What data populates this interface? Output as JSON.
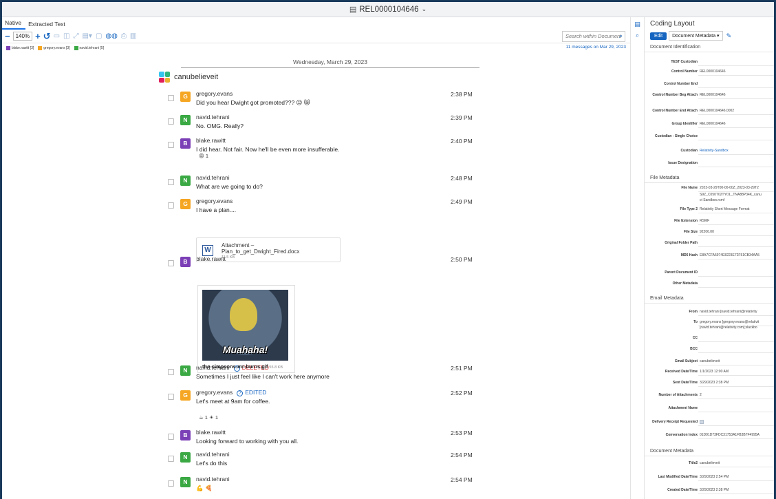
{
  "title": "REL0000104646",
  "tabs": [
    "Native",
    "Extracted Text"
  ],
  "toolbar": {
    "zoom": "140%"
  },
  "search": {
    "placeholder": "Search within Document"
  },
  "filters": [
    {
      "label": "blake.rawitt [3]",
      "color": "#7b3fb6"
    },
    {
      "label": "gregory.evans [3]",
      "color": "#f5a623"
    },
    {
      "label": "navid.tehrani [5]",
      "color": "#3aa843"
    }
  ],
  "message_count": "11 messages on Mar 29, 2023",
  "chat": {
    "date": "Wednesday, March 29, 2023",
    "channel": "canubelieveit",
    "messages": [
      {
        "user": "gregory.evans",
        "initial": "G",
        "color": "#f5a623",
        "text": "Did you hear Dwight got promoted??? 😐 😿",
        "time": "2:38 PM"
      },
      {
        "user": "navid.tehrani",
        "initial": "N",
        "color": "#3aa843",
        "text": "No. OMG. Really?",
        "time": "2:39 PM"
      },
      {
        "user": "blake.rawitt",
        "initial": "B",
        "color": "#7b3fb6",
        "text": "I did hear. Not fair. Now he'll be even more insufferable.",
        "time": "2:40 PM",
        "reaction": "😡 1"
      },
      {
        "user": "navid.tehrani",
        "initial": "N",
        "color": "#3aa843",
        "text": "What are we going to do?",
        "time": "2:48 PM"
      },
      {
        "user": "gregory.evans",
        "initial": "G",
        "color": "#f5a623",
        "text": "I have a plan....",
        "time": "2:49 PM"
      },
      {
        "user": "blake.rawitt",
        "initial": "B",
        "color": "#7b3fb6",
        "text": "",
        "time": "2:50 PM"
      },
      {
        "user": "navid.tehrani",
        "initial": "N",
        "color": "#3aa843",
        "text": "Sometimes I just feel like I can't work here anymore",
        "time": "2:51 PM",
        "tag": "DELETED"
      },
      {
        "user": "gregory.evans",
        "initial": "G",
        "color": "#f5a623",
        "text": "Let's meet at 9am for coffee.",
        "time": "2:52 PM",
        "tag": "EDITED",
        "reaction": "☕ 1    ☀ 1"
      },
      {
        "user": "blake.rawitt",
        "initial": "B",
        "color": "#7b3fb6",
        "text": "Looking forward to working with you all.",
        "time": "2:53 PM"
      },
      {
        "user": "navid.tehrani",
        "initial": "N",
        "color": "#3aa843",
        "text": "Let's do this",
        "time": "2:54 PM"
      },
      {
        "user": "navid.tehrani",
        "initial": "N",
        "color": "#3aa843",
        "text": "💪 🍕",
        "time": "2:54 PM"
      }
    ],
    "attachment": {
      "line1": "Attachment –",
      "line2": "Plan_to_get_Dwight_Fired.docx",
      "size": "11.5 KB",
      "icon": "word-icon"
    },
    "gif": {
      "caption": "Muahaha!",
      "filename": "the-simpsons-mr-burns.gif",
      "size": "55.8 KB"
    }
  },
  "coding": {
    "title": "Coding Layout",
    "edit": "Edit",
    "layout": "Document Metadata",
    "sections": {
      "id": "Document Identification",
      "file": "File Metadata",
      "email": "Email Metadata",
      "doc": "Document Metadata"
    },
    "fields": [
      {
        "label": "TEST Custodian",
        "value": ""
      },
      {
        "label": "Control Number",
        "value": "REL0000104646"
      },
      {
        "label": "Control Number End",
        "value": ""
      },
      {
        "label": "Control Number Beg Attach",
        "value": "REL0000104646"
      },
      {
        "label": "Control Number End Attach",
        "value": "REL0000104646.0002"
      },
      {
        "label": "Group Identifier",
        "value": "REL0000104646"
      },
      {
        "label": "Custodian - Single Choice",
        "value": ""
      },
      {
        "label": "Custodian",
        "value": "Relativity-Sandbox"
      },
      {
        "label": "Issue Designation",
        "value": ""
      },
      {
        "label": "File Name",
        "value": "2023-03-29T00-00-00Z_2023-03-29T2"
      },
      {
        "label": "",
        "value": "S9Z_C050T02TYOL_TNA88P34K_canu"
      },
      {
        "label": "",
        "value": "ct Sandbox.rsmf"
      },
      {
        "label": "File Type 2",
        "value": "Relativity Short Message Format"
      },
      {
        "label": "File Extension",
        "value": "RSMF"
      },
      {
        "label": "File Size",
        "value": "92206.00"
      },
      {
        "label": "Original Folder Path",
        "value": ""
      },
      {
        "label": "MD5 Hash",
        "value": "E8A7CFA5974E8223E72F51CB34AA5"
      },
      {
        "label": "Parent Document ID",
        "value": ""
      },
      {
        "label": "Other Metadata",
        "value": ""
      },
      {
        "label": "From",
        "value": "navid.tehrani [navid.tehrani@relativity"
      },
      {
        "label": "To",
        "value": "gregory.evans [gregory.evans@relativit"
      },
      {
        "label": "",
        "value": "[navid.tehrani@relativity.com];slackbo"
      },
      {
        "label": "CC",
        "value": ""
      },
      {
        "label": "BCC",
        "value": ""
      },
      {
        "label": "Email Subject",
        "value": "canubelieveit"
      },
      {
        "label": "Received Date/Time",
        "value": "1/1/2023 12:00 AM"
      },
      {
        "label": "Sent Date/Time",
        "value": "3/29/2023 2:38 PM"
      },
      {
        "label": "Number of Attachments",
        "value": "2"
      },
      {
        "label": "Attachment Name",
        "value": ""
      },
      {
        "label": "Delivery Receipt Requested",
        "value": ""
      },
      {
        "label": "Conversation Index",
        "value": "01D91D73FDC31753A1FB3B7F4995A"
      },
      {
        "label": "Title2",
        "value": "canubelieveit"
      },
      {
        "label": "Last Modified Date/Time",
        "value": "3/29/2023 2:54 PM"
      },
      {
        "label": "Created Date/Time",
        "value": "3/29/2023 2:38 PM"
      }
    ]
  }
}
